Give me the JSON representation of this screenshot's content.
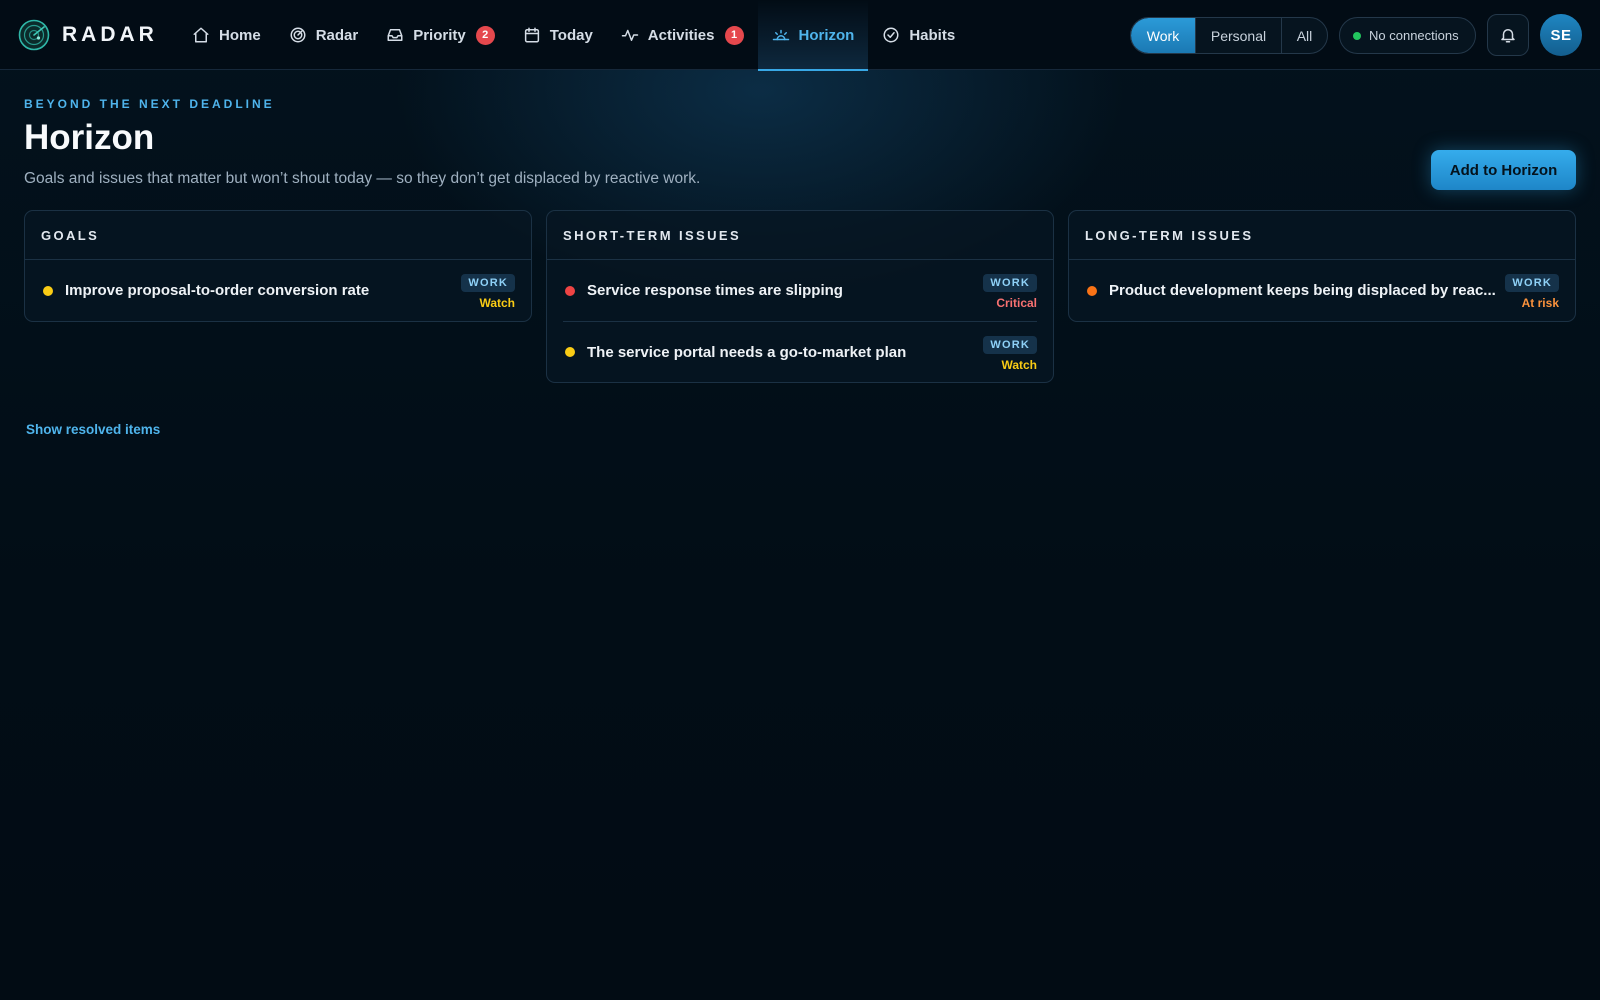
{
  "app": {
    "name": "RADAR"
  },
  "nav": [
    {
      "label": "Home",
      "icon": "home-icon",
      "badge": null,
      "active": false
    },
    {
      "label": "Radar",
      "icon": "radar-icon",
      "badge": null,
      "active": false
    },
    {
      "label": "Priority",
      "icon": "inbox-icon",
      "badge": "2",
      "active": false
    },
    {
      "label": "Today",
      "icon": "calendar-icon",
      "badge": null,
      "active": false
    },
    {
      "label": "Activities",
      "icon": "activity-icon",
      "badge": "1",
      "active": false
    },
    {
      "label": "Horizon",
      "icon": "horizon-icon",
      "badge": null,
      "active": true
    },
    {
      "label": "Habits",
      "icon": "check-circle-icon",
      "badge": null,
      "active": false
    }
  ],
  "scope": {
    "work": "Work",
    "personal": "Personal",
    "all": "All",
    "selected": "Work"
  },
  "connections": {
    "label": "No connections",
    "status_color": "#22c55e"
  },
  "user": {
    "initials": "SE"
  },
  "header": {
    "eyebrow": "BEYOND THE NEXT DEADLINE",
    "title": "Horizon",
    "subtitle": "Goals and issues that matter but won’t shout today — so they don’t get displaced by reactive work.",
    "add_button": "Add to Horizon"
  },
  "colors": {
    "accent": "#38a8e6",
    "watch": "#facc15",
    "critical": "#ef4444",
    "at_risk": "#f97316"
  },
  "columns": {
    "goals": {
      "title": "GOALS",
      "items": [
        {
          "title": "Improve proposal-to-order conversion rate",
          "tag": "WORK",
          "status": "Watch",
          "status_color": "#facc15",
          "dot_color": "#facc15"
        }
      ]
    },
    "short_term": {
      "title": "SHORT-TERM ISSUES",
      "items": [
        {
          "title": "Service response times are slipping",
          "tag": "WORK",
          "status": "Critical",
          "status_color": "#f87171",
          "dot_color": "#ef4444"
        },
        {
          "title": "The service portal needs a go-to-market plan",
          "tag": "WORK",
          "status": "Watch",
          "status_color": "#facc15",
          "dot_color": "#facc15"
        }
      ]
    },
    "long_term": {
      "title": "LONG-TERM ISSUES",
      "items": [
        {
          "title": "Product development keeps being displaced by reac...",
          "tag": "WORK",
          "status": "At risk",
          "status_color": "#fb923c",
          "dot_color": "#f97316"
        }
      ]
    }
  },
  "footer": {
    "show_resolved": "Show resolved items"
  }
}
